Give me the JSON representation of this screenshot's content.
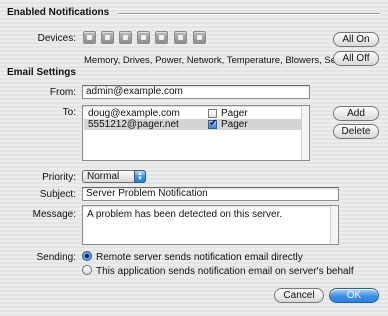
{
  "enabled_notifications": {
    "title": "Enabled Notifications",
    "devices_label": "Devices:",
    "device_icons": [
      "memory-icon",
      "drives-icon",
      "power-icon",
      "network-icon",
      "temperature-icon",
      "blowers-icon",
      "security-icon"
    ],
    "devices_caption": "Memory, Drives, Power, Network, Temperature, Blowers, Security",
    "all_on_label": "All On",
    "all_off_label": "All Off"
  },
  "email_settings": {
    "title": "Email Settings",
    "from_label": "From:",
    "from_value": "admin@example.com",
    "to_label": "To:",
    "recipients": [
      {
        "address": "doug@example.com",
        "pager_label": "Pager",
        "pager_checked": false
      },
      {
        "address": "5551212@pager.net",
        "pager_label": "Pager",
        "pager_checked": true
      }
    ],
    "add_label": "Add",
    "delete_label": "Delete",
    "priority_label": "Priority:",
    "priority_value": "Normal",
    "subject_label": "Subject:",
    "subject_value": "Server Problem Notification",
    "message_label": "Message:",
    "message_value": "A problem has been detected on this server.",
    "sending_label": "Sending:",
    "sending_options": [
      {
        "label": "Remote server sends notification email directly",
        "selected": true
      },
      {
        "label": "This application sends notification email on server's behalf",
        "selected": false
      }
    ]
  },
  "footer": {
    "cancel_label": "Cancel",
    "ok_label": "OK"
  }
}
